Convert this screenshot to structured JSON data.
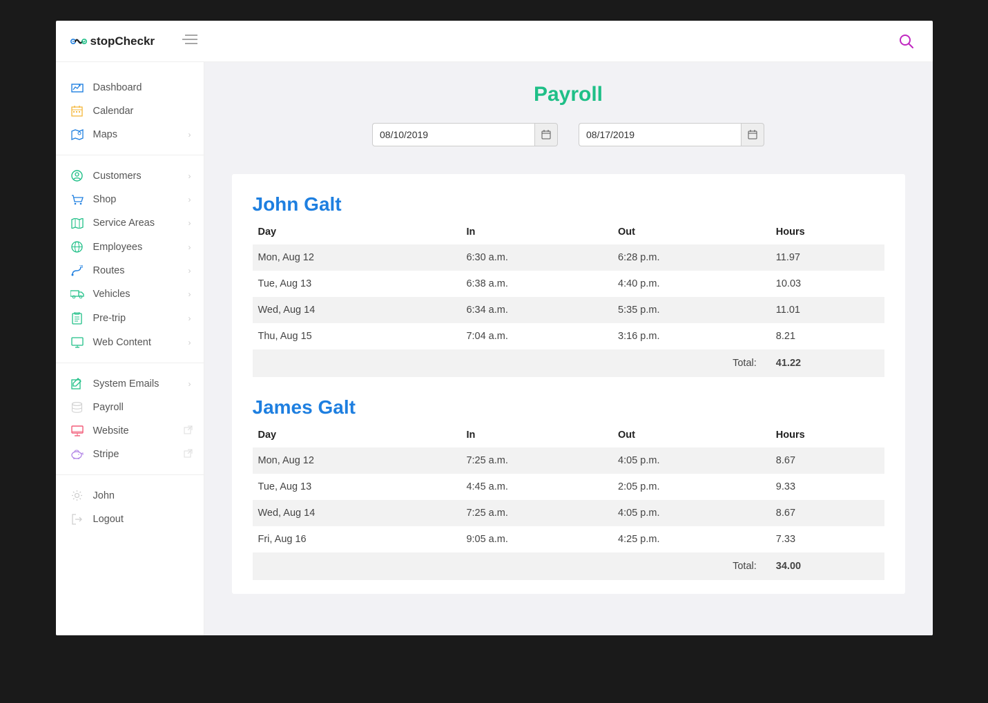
{
  "brand": {
    "name": "stopCheckr"
  },
  "page": {
    "title": "Payroll"
  },
  "dates": {
    "from": "08/10/2019",
    "to": "08/17/2019"
  },
  "sidebar": {
    "group1": [
      {
        "label": "Dashboard",
        "icon": "dashboard",
        "color": "#1e7fe0"
      },
      {
        "label": "Calendar",
        "icon": "calendar",
        "color": "#f5b73a"
      },
      {
        "label": "Maps",
        "icon": "map",
        "color": "#1e7fe0",
        "chev": true
      }
    ],
    "group2": [
      {
        "label": "Customers",
        "icon": "user",
        "color": "#1fbf87",
        "chev": true
      },
      {
        "label": "Shop",
        "icon": "cart",
        "color": "#1e7fe0",
        "chev": true
      },
      {
        "label": "Service Areas",
        "icon": "mapthin",
        "color": "#1fbf87",
        "chev": true
      },
      {
        "label": "Employees",
        "icon": "globe",
        "color": "#1fbf87",
        "chev": true
      },
      {
        "label": "Routes",
        "icon": "route",
        "color": "#1e7fe0",
        "chev": true
      },
      {
        "label": "Vehicles",
        "icon": "truck",
        "color": "#1fbf87",
        "chev": true
      },
      {
        "label": "Pre-trip",
        "icon": "clip",
        "color": "#1fbf87",
        "chev": true
      },
      {
        "label": "Web Content",
        "icon": "monitor",
        "color": "#1fbf87",
        "chev": true
      }
    ],
    "group3": [
      {
        "label": "System Emails",
        "icon": "edit",
        "color": "#1fbf87",
        "chev": true
      },
      {
        "label": "Payroll",
        "icon": "stack",
        "color": "#cfcfcf"
      },
      {
        "label": "Website",
        "icon": "desktop",
        "color": "#f25c78",
        "ext": true
      },
      {
        "label": "Stripe",
        "icon": "piggy",
        "color": "#b083e6",
        "ext": true
      }
    ],
    "group4": [
      {
        "label": "John",
        "icon": "gear",
        "color": "#cfcfcf"
      },
      {
        "label": "Logout",
        "icon": "logout",
        "color": "#cfcfcf"
      }
    ]
  },
  "table": {
    "headers": {
      "day": "Day",
      "in": "In",
      "out": "Out",
      "hours": "Hours"
    },
    "total_label": "Total:"
  },
  "employees": [
    {
      "name": "John Galt",
      "rows": [
        {
          "day": "Mon, Aug 12",
          "in": "6:30 a.m.",
          "out": "6:28 p.m.",
          "hours": "11.97"
        },
        {
          "day": "Tue, Aug 13",
          "in": "6:38 a.m.",
          "out": "4:40 p.m.",
          "hours": "10.03"
        },
        {
          "day": "Wed, Aug 14",
          "in": "6:34 a.m.",
          "out": "5:35 p.m.",
          "hours": "11.01"
        },
        {
          "day": "Thu, Aug 15",
          "in": "7:04 a.m.",
          "out": "3:16 p.m.",
          "hours": "8.21"
        }
      ],
      "total": "41.22"
    },
    {
      "name": "James Galt",
      "rows": [
        {
          "day": "Mon, Aug 12",
          "in": "7:25 a.m.",
          "out": "4:05 p.m.",
          "hours": "8.67"
        },
        {
          "day": "Tue, Aug 13",
          "in": "4:45 a.m.",
          "out": "2:05 p.m.",
          "hours": "9.33"
        },
        {
          "day": "Wed, Aug 14",
          "in": "7:25 a.m.",
          "out": "4:05 p.m.",
          "hours": "8.67"
        },
        {
          "day": "Fri, Aug 16",
          "in": "9:05 a.m.",
          "out": "4:25 p.m.",
          "hours": "7.33"
        }
      ],
      "total": "34.00"
    }
  ]
}
